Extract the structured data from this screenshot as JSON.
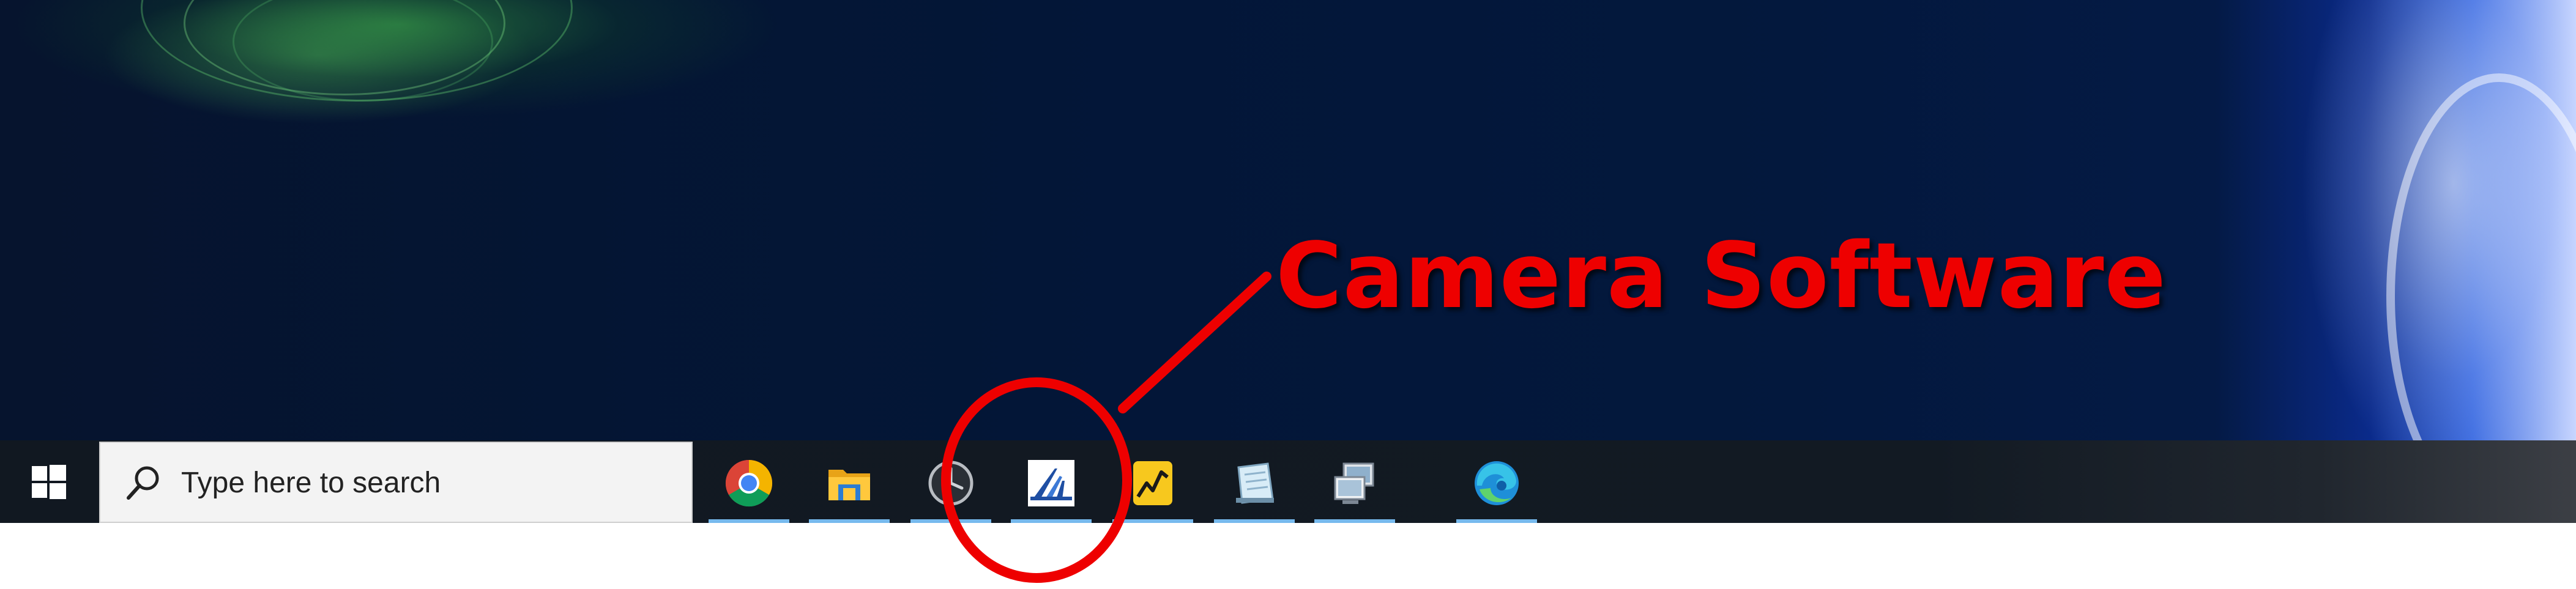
{
  "annotation": {
    "label": "Camera Software",
    "color": "#ee0000"
  },
  "taskbar": {
    "start_icon": "windows-logo-icon",
    "search": {
      "placeholder": "Type here to search",
      "icon": "search-icon"
    },
    "apps": [
      {
        "icon": "chrome-icon",
        "running": true
      },
      {
        "icon": "file-explorer-icon",
        "running": true
      },
      {
        "icon": "clock-app-icon",
        "running": true
      },
      {
        "icon": "camera-software-icon",
        "running": true
      },
      {
        "icon": "yellow-graph-app-icon",
        "running": true
      },
      {
        "icon": "notepad-app-icon",
        "running": true
      },
      {
        "icon": "network-computers-icon",
        "running": true
      },
      {
        "icon": "edge-icon",
        "running": true
      }
    ]
  },
  "colors": {
    "taskbar": "#111821",
    "running_indicator": "#76b9ed",
    "annotation": "#ee0000"
  }
}
